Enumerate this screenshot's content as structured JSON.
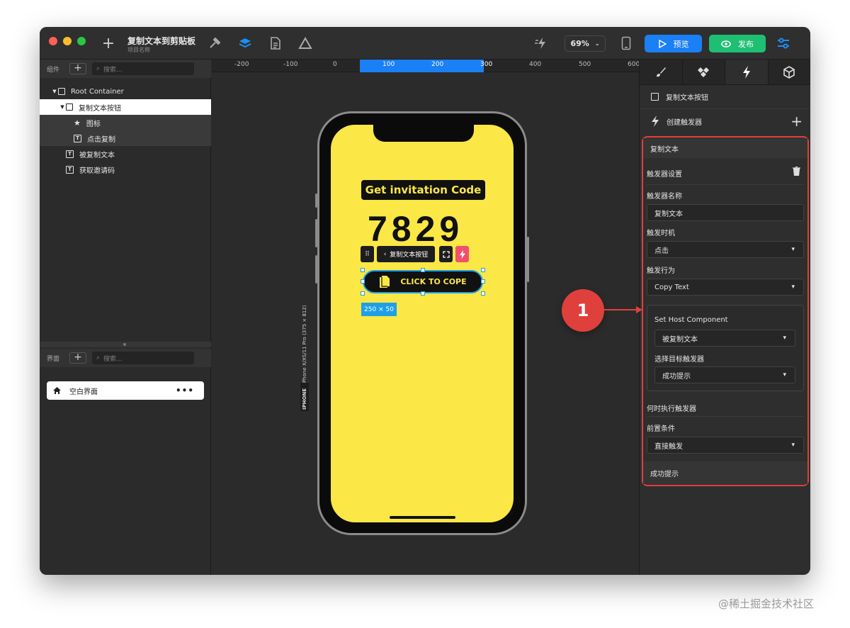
{
  "titlebar": {
    "project_title": "复制文本到剪贴板",
    "project_subtitle": "项目名称",
    "zoom": "69%",
    "preview_label": "预览",
    "publish_label": "发布"
  },
  "components_panel": {
    "label": "组件",
    "search_placeholder": "搜索...",
    "tree": [
      {
        "label": "Root Container"
      },
      {
        "label": "复制文本按钮"
      },
      {
        "label": "图标"
      },
      {
        "label": "点击复制"
      },
      {
        "label": "被复制文本"
      },
      {
        "label": "获取邀请码"
      }
    ]
  },
  "pages_panel": {
    "label": "界面",
    "search_placeholder": "搜索...",
    "pages": [
      {
        "label": "空白界面"
      }
    ]
  },
  "ruler": {
    "ticks": [
      "-200",
      "-100",
      "0",
      "100",
      "200",
      "300",
      "400",
      "500",
      "600"
    ]
  },
  "canvas": {
    "device_label": "iPhone X/XS/11 Pro (375 × 812)",
    "device_tag": "IPHONE",
    "invite_title": "Get invitation Code",
    "invite_code": "7829",
    "selection_toolbar_label": "复制文本按钮",
    "copy_button_label": "CLICK TO COPE",
    "size_tag": "250 × 50"
  },
  "right_panel": {
    "selected_component": "复制文本按钮",
    "create_trigger": "创建触发器",
    "trigger_title": "复制文本",
    "trigger_settings": "触发器设置",
    "trigger_name_label": "触发器名称",
    "trigger_name_value": "复制文本",
    "trigger_timing_label": "触发时机",
    "trigger_timing_value": "点击",
    "trigger_action_label": "触发行为",
    "trigger_action_value": "Copy Text",
    "host_component_label": "Set Host Component",
    "host_component_value": "被复制文本",
    "target_trigger_label": "选择目标触发器",
    "target_trigger_value": "成功提示",
    "when_label": "何时执行触发器",
    "precondition_label": "前置条件",
    "precondition_value": "直接触发",
    "next_section": "成功提示"
  },
  "annotation": {
    "number": "1",
    "color": "#e0403c"
  },
  "watermark": "@稀土掘金技术社区",
  "colors": {
    "accent_blue": "#1b7ff5",
    "publish_green": "#1fbf73",
    "screen_yellow": "#fbe745"
  }
}
